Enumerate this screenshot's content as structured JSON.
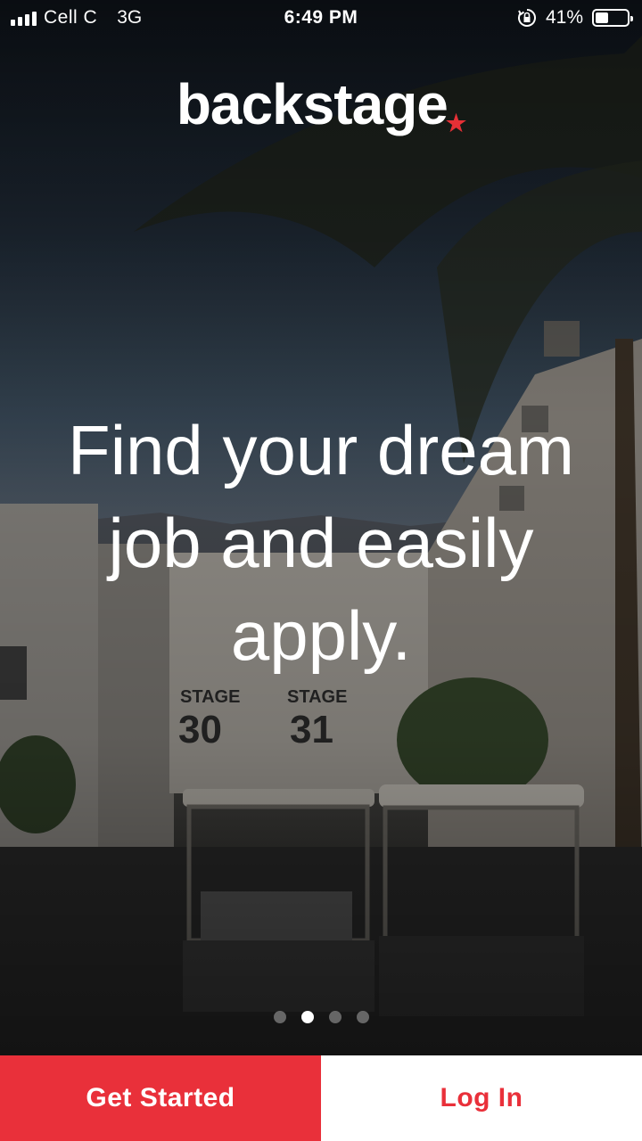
{
  "status_bar": {
    "carrier": "Cell C",
    "network": "3G",
    "time": "6:49 PM",
    "battery_percent": "41%",
    "battery_level": 0.41
  },
  "brand": {
    "logo": "backstage",
    "accent_color": "#e9303a"
  },
  "onboarding": {
    "headline_lines": [
      "Find your dream",
      "job and easily",
      "apply."
    ],
    "page_count": 4,
    "active_page": 2
  },
  "actions": {
    "get_started_label": "Get Started",
    "log_in_label": "Log In"
  },
  "icons": {
    "signal": "signal-bars-icon",
    "orientation_lock": "orientation-lock-icon",
    "battery": "battery-icon",
    "logo_star": "star-icon"
  }
}
